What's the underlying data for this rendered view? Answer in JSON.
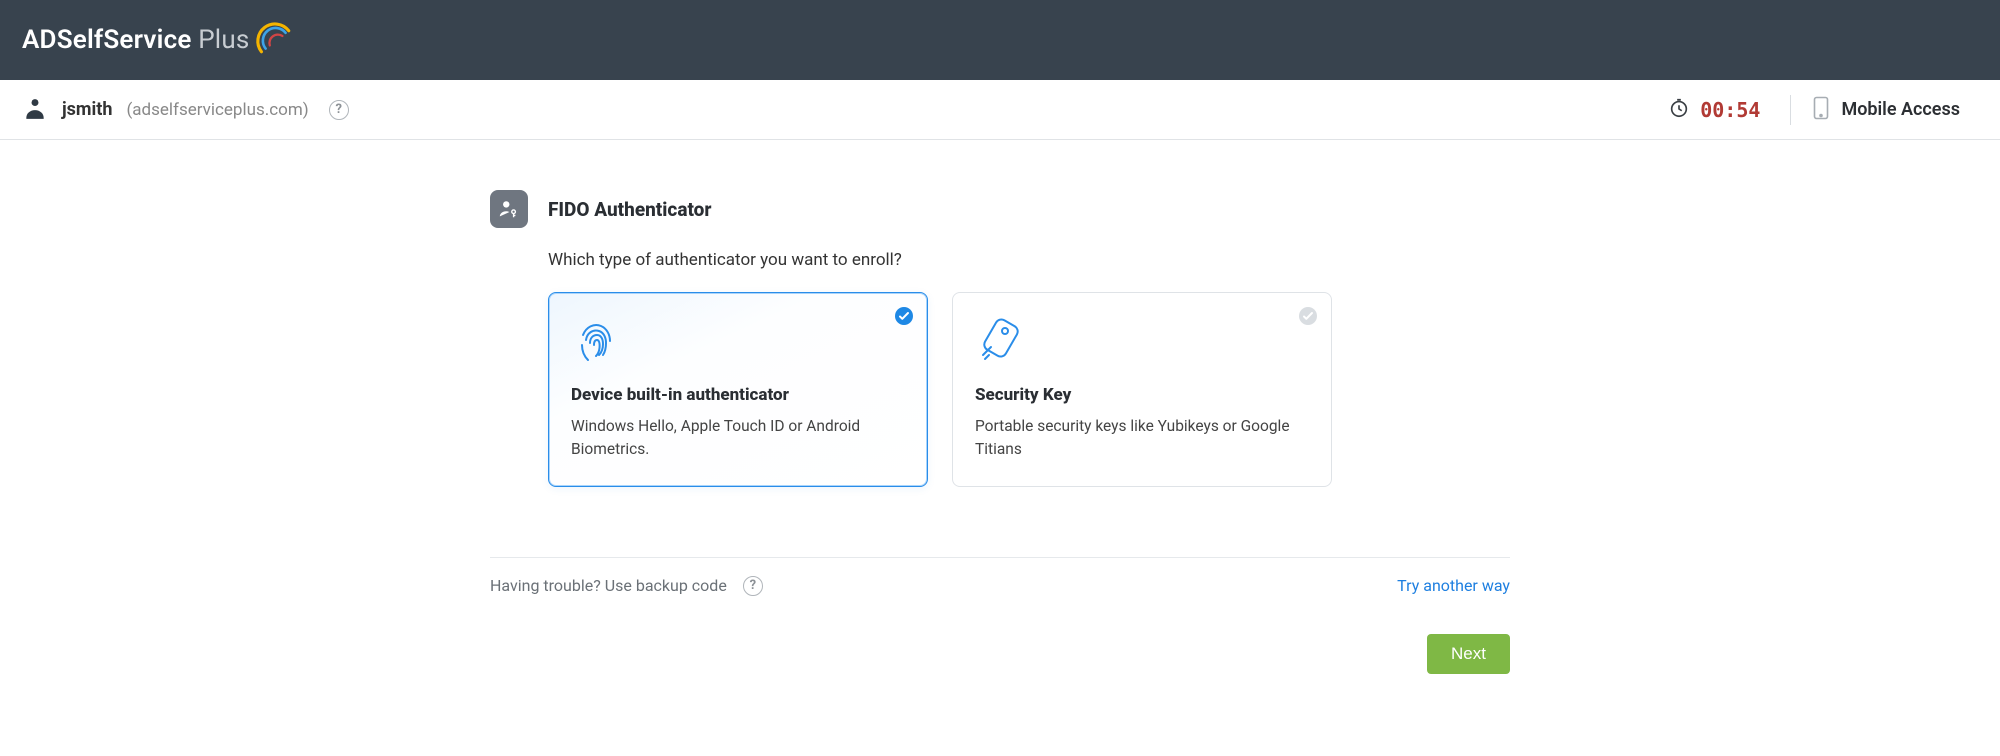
{
  "brand": {
    "name": "ADSelfService",
    "suffix": "Plus"
  },
  "user": {
    "name": "jsmith",
    "domain": "(adselfserviceplus.com)"
  },
  "timer": {
    "value": "00:54"
  },
  "mobile": {
    "label": "Mobile Access"
  },
  "section": {
    "title": "FIDO Authenticator",
    "prompt": "Which type of authenticator you want to enroll?"
  },
  "cards": [
    {
      "title": "Device built-in authenticator",
      "desc": "Windows Hello, Apple Touch ID or Android Biometrics.",
      "selected": true
    },
    {
      "title": "Security Key",
      "desc": "Portable security keys like Yubikeys or Google Titians",
      "selected": false
    }
  ],
  "footer": {
    "trouble": "Having trouble? Use backup code",
    "try_another": "Try another way"
  },
  "actions": {
    "next": "Next"
  }
}
